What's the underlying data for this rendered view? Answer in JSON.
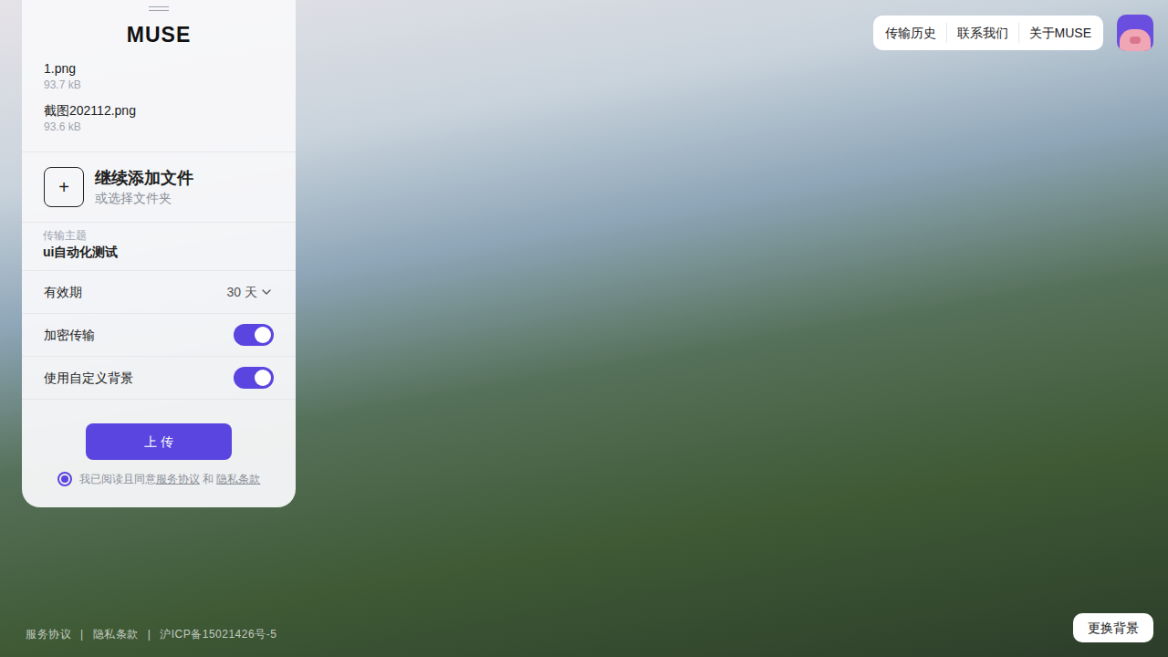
{
  "brand": "MUSE",
  "files": [
    {
      "name": "1.png",
      "size": "93.7 kB"
    },
    {
      "name": "截图202112.png",
      "size": "93.6 kB"
    }
  ],
  "add_files": {
    "icon": "+",
    "label": "继续添加文件",
    "sublabel": "或选择文件夹"
  },
  "subject": {
    "label": "传输主题",
    "value": "ui自动化测试"
  },
  "settings": [
    {
      "kind": "select",
      "label": "有效期",
      "value": "30 天"
    },
    {
      "kind": "toggle",
      "label": "加密传输",
      "on": true
    },
    {
      "kind": "toggle",
      "label": "使用自定义背景",
      "on": true
    }
  ],
  "upload_button": "上 传",
  "agreement": {
    "checked": true,
    "prefix": "我已阅读且同意",
    "links": [
      "服务协议",
      "隐私条款"
    ],
    "conjunction": "和"
  },
  "nav": [
    "传输历史",
    "联系我们",
    "关于MUSE"
  ],
  "footer": [
    "服务协议",
    "隐私条款",
    "沪ICP备15021426号-5"
  ],
  "footer_separator": "|",
  "change_background": "更换背景"
}
